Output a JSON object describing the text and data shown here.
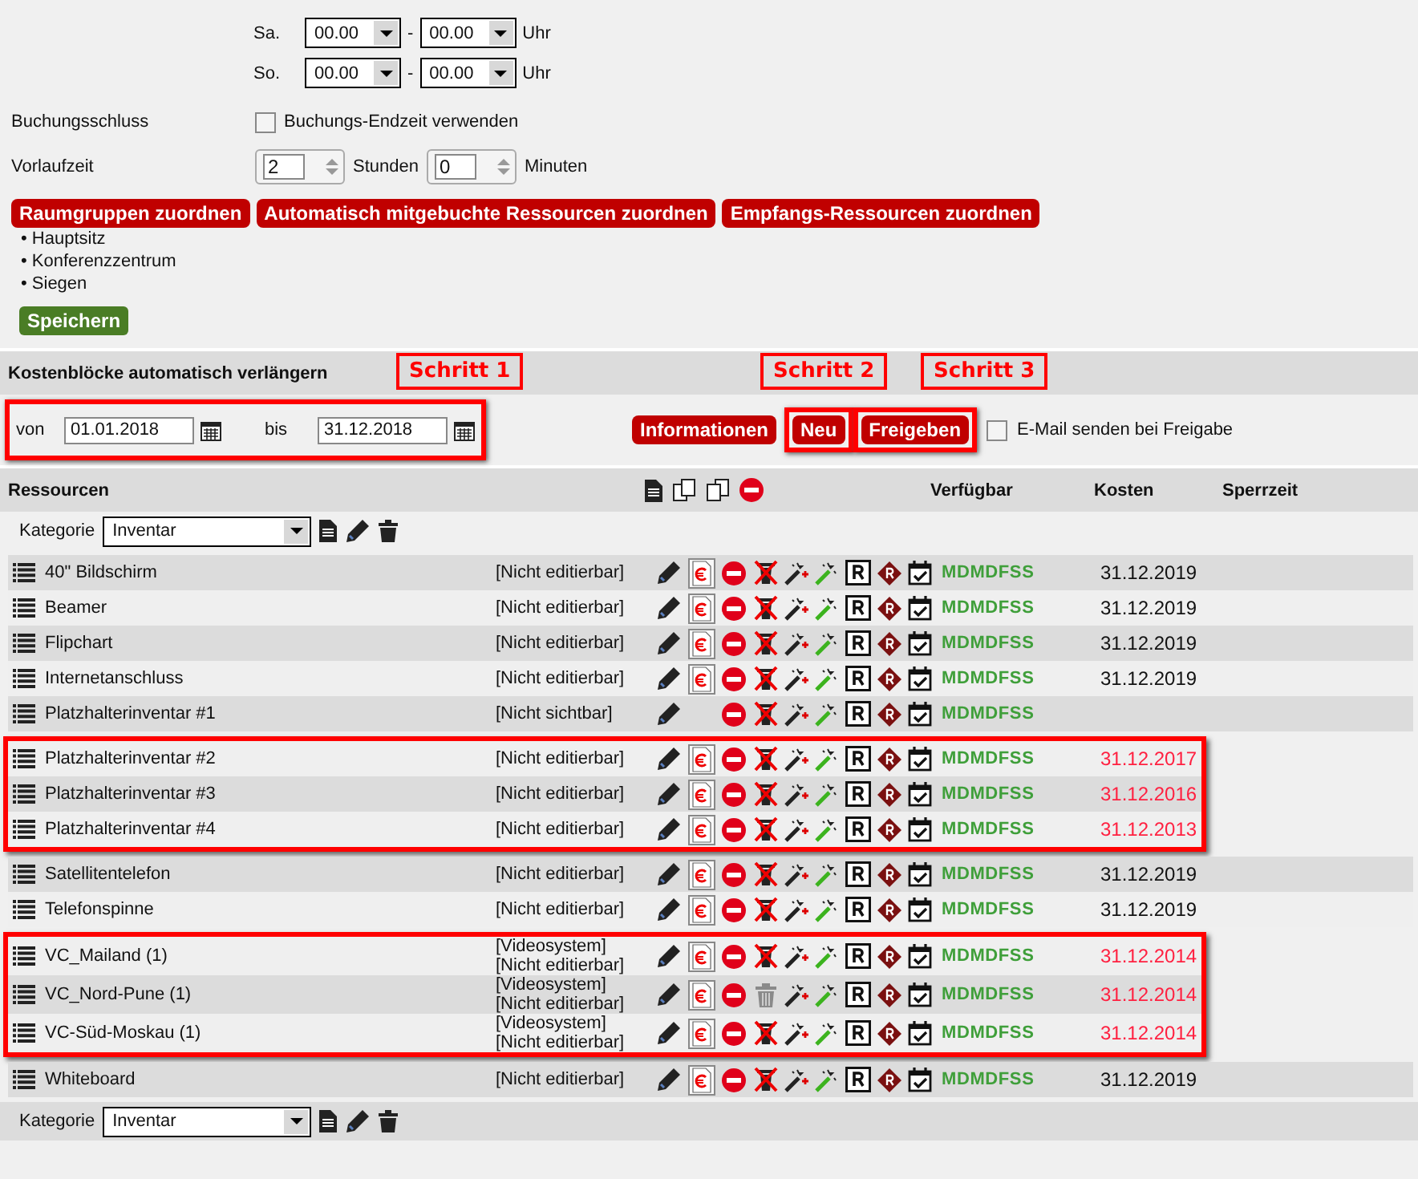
{
  "schedule": [
    {
      "day": "Sa.",
      "from": "00.00",
      "dash": "-",
      "to": "00.00",
      "unit": "Uhr"
    },
    {
      "day": "So.",
      "from": "00.00",
      "dash": "-",
      "to": "00.00",
      "unit": "Uhr"
    }
  ],
  "booking_end": {
    "label": "Buchungsschluss",
    "checkbox_label": "Buchungs-Endzeit verwenden",
    "checked": false
  },
  "lead_time": {
    "label": "Vorlaufzeit",
    "hours": "2",
    "hours_unit": "Stunden",
    "minutes": "0",
    "minutes_unit": "Minuten"
  },
  "assign_buttons": [
    "Raumgruppen zuordnen",
    "Automatisch mitgebuchte Ressourcen zuordnen",
    "Empfangs-Ressourcen zuordnen"
  ],
  "locations": [
    "• Hauptsitz",
    "• Konferenzzentrum",
    "• Siegen"
  ],
  "save_button": "Speichern",
  "cost_blocks": {
    "title": "Kostenblöcke automatisch verlängern",
    "steps": [
      "Schritt 1",
      "Schritt 2",
      "Schritt 3"
    ],
    "from_label": "von",
    "from_date": "01.01.2018",
    "to_label": "bis",
    "to_date": "31.12.2018",
    "range_highlighted": true,
    "buttons": [
      {
        "label": "Informationen",
        "highlighted": false
      },
      {
        "label": "Neu",
        "highlighted": true
      },
      {
        "label": "Freigeben",
        "highlighted": true
      }
    ],
    "email": {
      "label": "E-Mail senden bei Freigabe",
      "checked": false
    }
  },
  "table": {
    "columns": [
      "Ressourcen",
      "Verfügbar",
      "Kosten",
      "Sperrzeit"
    ],
    "category_label": "Kategorie",
    "category": "Inventar",
    "groups": [
      {
        "highlighted": false,
        "rows": [
          {
            "name": "40\" Bildschirm",
            "status": "[Nicht editierbar]",
            "cost_doc": true,
            "kind": "crossed",
            "availability": "MDMDFSS",
            "cost": "31.12.2019",
            "expired": false
          },
          {
            "name": "Beamer",
            "status": "[Nicht editierbar]",
            "cost_doc": true,
            "kind": "crossed",
            "availability": "MDMDFSS",
            "cost": "31.12.2019",
            "expired": false
          },
          {
            "name": "Flipchart",
            "status": "[Nicht editierbar]",
            "cost_doc": true,
            "kind": "crossed",
            "availability": "MDMDFSS",
            "cost": "31.12.2019",
            "expired": false
          },
          {
            "name": "Internetanschluss",
            "status": "[Nicht editierbar]",
            "cost_doc": true,
            "kind": "crossed",
            "availability": "MDMDFSS",
            "cost": "31.12.2019",
            "expired": false
          },
          {
            "name": "Platzhalterinventar #1",
            "status": "[Nicht sichtbar]",
            "cost_doc": false,
            "kind": "crossed",
            "availability": "MDMDFSS"
          }
        ]
      },
      {
        "highlighted": true,
        "rows": [
          {
            "name": "Platzhalterinventar #2",
            "status": "[Nicht editierbar]",
            "cost_doc": true,
            "kind": "crossed",
            "availability": "MDMDFSS",
            "cost": "31.12.2017",
            "expired": true
          },
          {
            "name": "Platzhalterinventar #3",
            "status": "[Nicht editierbar]",
            "cost_doc": true,
            "kind": "crossed",
            "availability": "MDMDFSS",
            "cost": "31.12.2016",
            "expired": true
          },
          {
            "name": "Platzhalterinventar #4",
            "status": "[Nicht editierbar]",
            "cost_doc": true,
            "kind": "crossed",
            "availability": "MDMDFSS",
            "cost": "31.12.2013",
            "expired": true
          }
        ]
      },
      {
        "highlighted": false,
        "rows": [
          {
            "name": "Satellitentelefon",
            "status": "[Nicht editierbar]",
            "cost_doc": true,
            "kind": "crossed",
            "availability": "MDMDFSS",
            "cost": "31.12.2019",
            "expired": false
          },
          {
            "name": "Telefonspinne",
            "status": "[Nicht editierbar]",
            "cost_doc": true,
            "kind": "crossed",
            "availability": "MDMDFSS",
            "cost": "31.12.2019",
            "expired": false
          }
        ]
      },
      {
        "highlighted": true,
        "rows": [
          {
            "name": "VC_Mailand (1)",
            "status": "[Videosystem] [Nicht editierbar]",
            "cost_doc": true,
            "kind": "crossed",
            "availability": "MDMDFSS",
            "cost": "31.12.2014",
            "expired": true
          },
          {
            "name": "VC_Nord-Pune (1)",
            "status": "[Videosystem] [Nicht editierbar]",
            "cost_doc": true,
            "kind": "trash",
            "availability": "MDMDFSS",
            "cost": "31.12.2014",
            "expired": true
          },
          {
            "name": "VC-Süd-Moskau (1)",
            "status": "[Videosystem] [Nicht editierbar]",
            "cost_doc": true,
            "kind": "crossed",
            "availability": "MDMDFSS",
            "cost": "31.12.2014",
            "expired": true
          }
        ]
      },
      {
        "highlighted": false,
        "rows": [
          {
            "name": "Whiteboard",
            "status": "[Nicht editierbar]",
            "cost_doc": true,
            "kind": "crossed",
            "availability": "MDMDFSS",
            "cost": "31.12.2019",
            "expired": false
          }
        ]
      }
    ],
    "footer_category_label": "Kategorie",
    "footer_category": "Inventar"
  }
}
